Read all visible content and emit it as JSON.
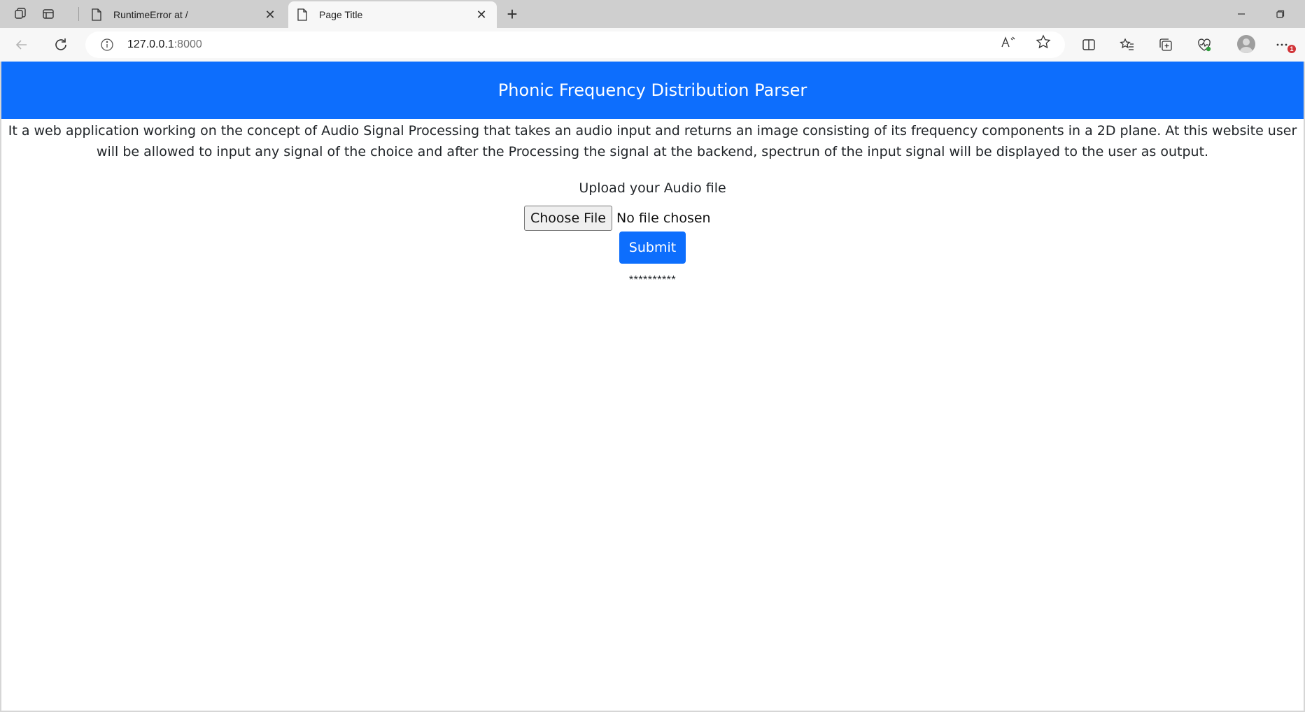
{
  "browser": {
    "tabs": [
      {
        "title": "RuntimeError at /",
        "active": false
      },
      {
        "title": "Page Title",
        "active": true
      }
    ],
    "address": {
      "host": "127.0.0.1",
      "port": ":8000"
    },
    "notification_badge": "1",
    "icons": [
      "workspaces-icon",
      "tab-actions-icon",
      "back-icon",
      "refresh-icon",
      "site-info-icon",
      "read-aloud-icon",
      "favorite-star-icon",
      "split-screen-icon",
      "favorites-icon",
      "collections-icon",
      "browser-essentials-icon",
      "profile-avatar",
      "more-menu-icon"
    ]
  },
  "page": {
    "brand": "Phonic Frequency Distribution Parser",
    "description": "It a web application working on the concept of Audio Signal Processing that takes an audio input and returns an image consisting of its frequency components in a 2D plane. At this website user will be allowed to input any signal of the choice and after the Processing the signal at the backend, spectrun of the input signal will be displayed to the user as output.",
    "upload_label": "Upload your Audio file",
    "choose_file_label": "Choose File",
    "file_status": "No file chosen",
    "submit_label": "Submit",
    "result_text": "**********"
  },
  "colors": {
    "primary": "#0d6efd",
    "text": "#212529",
    "badge": "#d13438"
  }
}
